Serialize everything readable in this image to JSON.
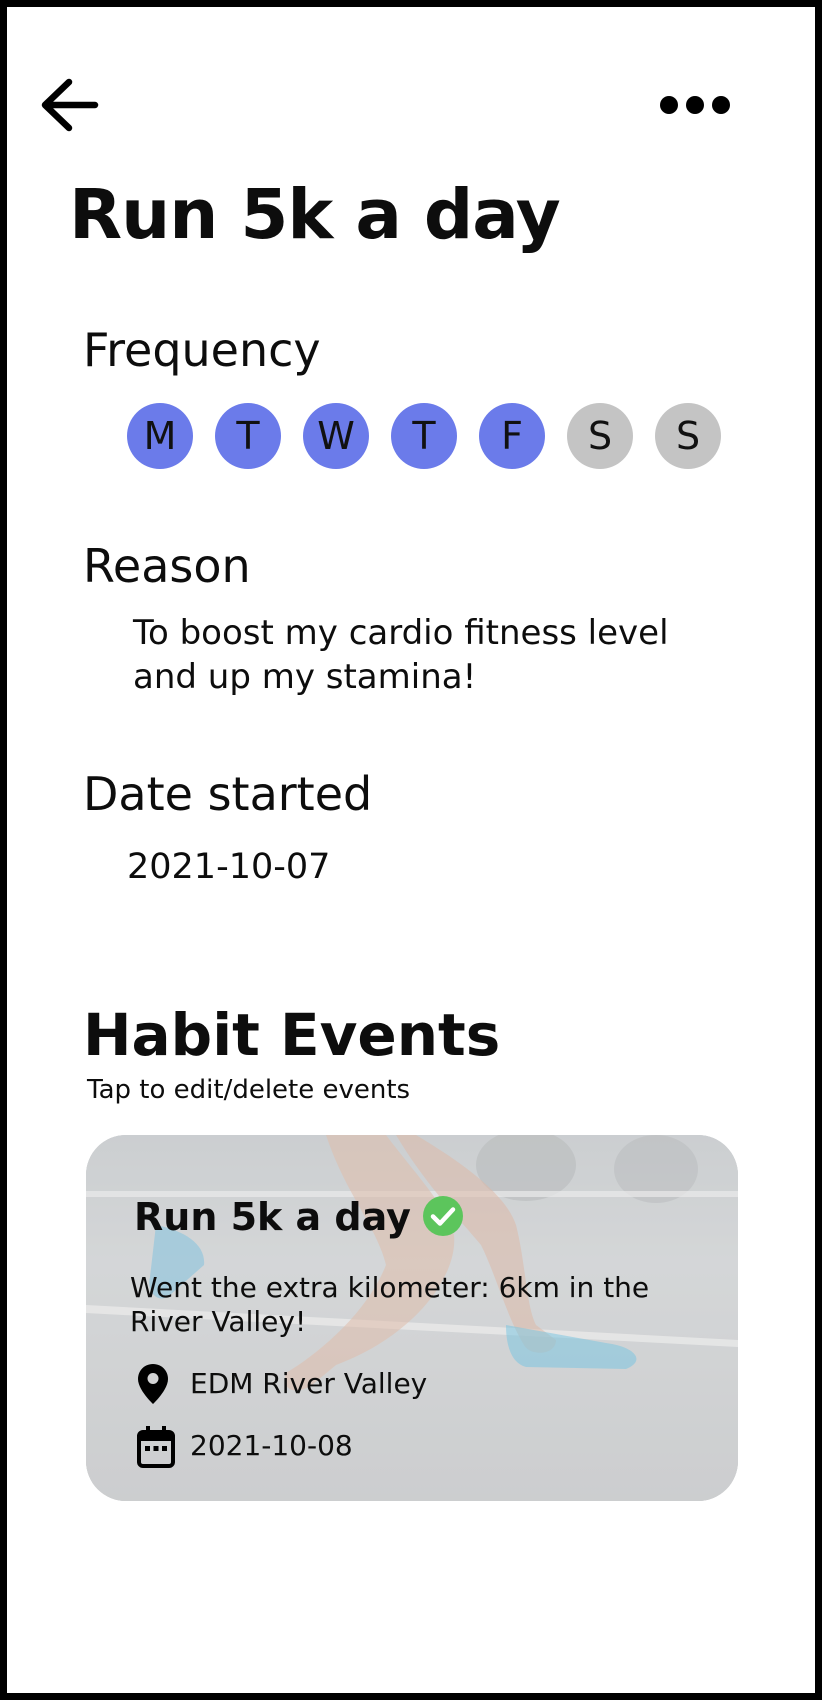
{
  "header": {
    "back_icon": "arrow-left-icon",
    "more_icon": "more-horizontal-icon"
  },
  "habit": {
    "title": "Run 5k a day",
    "frequency_label": "Frequency",
    "days": [
      {
        "letter": "M",
        "active": true
      },
      {
        "letter": "T",
        "active": true
      },
      {
        "letter": "W",
        "active": true
      },
      {
        "letter": "T",
        "active": true
      },
      {
        "letter": "F",
        "active": true
      },
      {
        "letter": "S",
        "active": false
      },
      {
        "letter": "S",
        "active": false
      }
    ],
    "reason_label": "Reason",
    "reason_text": "To boost my cardio fitness level and up my stamina!",
    "date_label": "Date started",
    "date_started": "2021-10-07"
  },
  "events": {
    "heading": "Habit Events",
    "hint": "Tap to edit/delete events",
    "items": [
      {
        "title": "Run 5k a day",
        "completed_icon": "check-circle-icon",
        "description": "Went the extra kilometer: 6km in the River Valley!",
        "location_icon": "location-pin-icon",
        "location": "EDM River Valley",
        "date_icon": "calendar-icon",
        "date": "2021-10-08"
      }
    ]
  },
  "colors": {
    "day_active": "#6b7bea",
    "day_inactive": "#c4c4c4",
    "check": "#5cc55c",
    "text": "#0d0d0d"
  }
}
